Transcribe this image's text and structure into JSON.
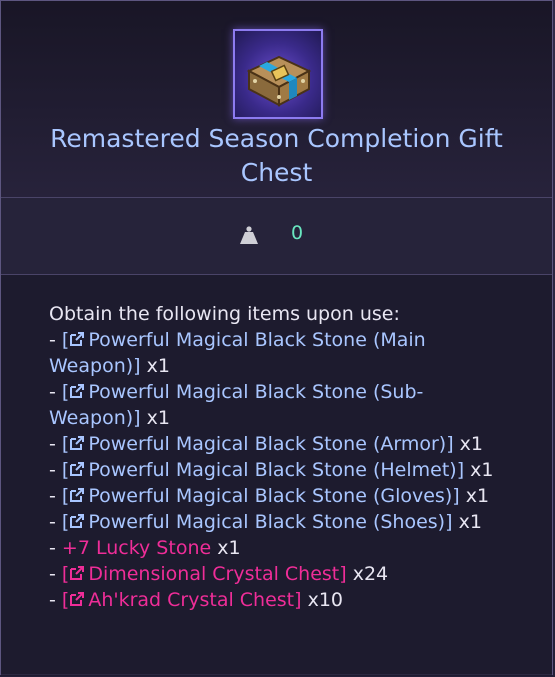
{
  "item": {
    "title": "Remastered Season Completion Gift Chest",
    "icon": "gift-chest-icon"
  },
  "stat": {
    "icon": "weight-icon",
    "value": "0"
  },
  "description": {
    "heading": "Obtain the following items upon use:",
    "items": [
      {
        "prefix": "- ",
        "open": "[",
        "label": "Powerful Magical Black Stone (Main Weapon)",
        "close": "]",
        "qty": " x1",
        "link": true,
        "color": "#a9c6ff"
      },
      {
        "prefix": "- ",
        "open": "[",
        "label": "Powerful Magical Black Stone (Sub-Weapon)",
        "close": "]",
        "qty": " x1",
        "link": true,
        "color": "#a9c6ff"
      },
      {
        "prefix": "- ",
        "open": "[",
        "label": "Powerful Magical Black Stone (Armor)",
        "close": "]",
        "qty": " x1",
        "link": true,
        "color": "#a9c6ff"
      },
      {
        "prefix": "- ",
        "open": "[",
        "label": "Powerful Magical Black Stone (Helmet)",
        "close": "]",
        "qty": " x1",
        "link": true,
        "color": "#a9c6ff"
      },
      {
        "prefix": "- ",
        "open": "[",
        "label": "Powerful Magical Black Stone (Gloves)",
        "close": "]",
        "qty": " x1",
        "link": true,
        "color": "#a9c6ff"
      },
      {
        "prefix": "- ",
        "open": "[",
        "label": "Powerful Magical Black Stone (Shoes)",
        "close": "]",
        "qty": " x1",
        "link": true,
        "color": "#a9c6ff"
      },
      {
        "prefix": "- ",
        "open": "",
        "label": "+7 Lucky Stone",
        "close": "",
        "qty": " x1",
        "link": false,
        "color": "#ef2d98"
      },
      {
        "prefix": "- ",
        "open": "[",
        "label": "Dimensional Crystal Chest",
        "close": "]",
        "qty": " x24",
        "link": true,
        "color": "#ef2d98"
      },
      {
        "prefix": "- ",
        "open": "[",
        "label": "Ah'krad Crystal Chest",
        "close": "]",
        "qty": " x10",
        "link": true,
        "color": "#ef2d98"
      }
    ]
  },
  "colors": {
    "title": "#a9c6ff",
    "link_blue": "#a9c6ff",
    "link_pink": "#ef2d98",
    "stat_value": "#69e7c0"
  }
}
